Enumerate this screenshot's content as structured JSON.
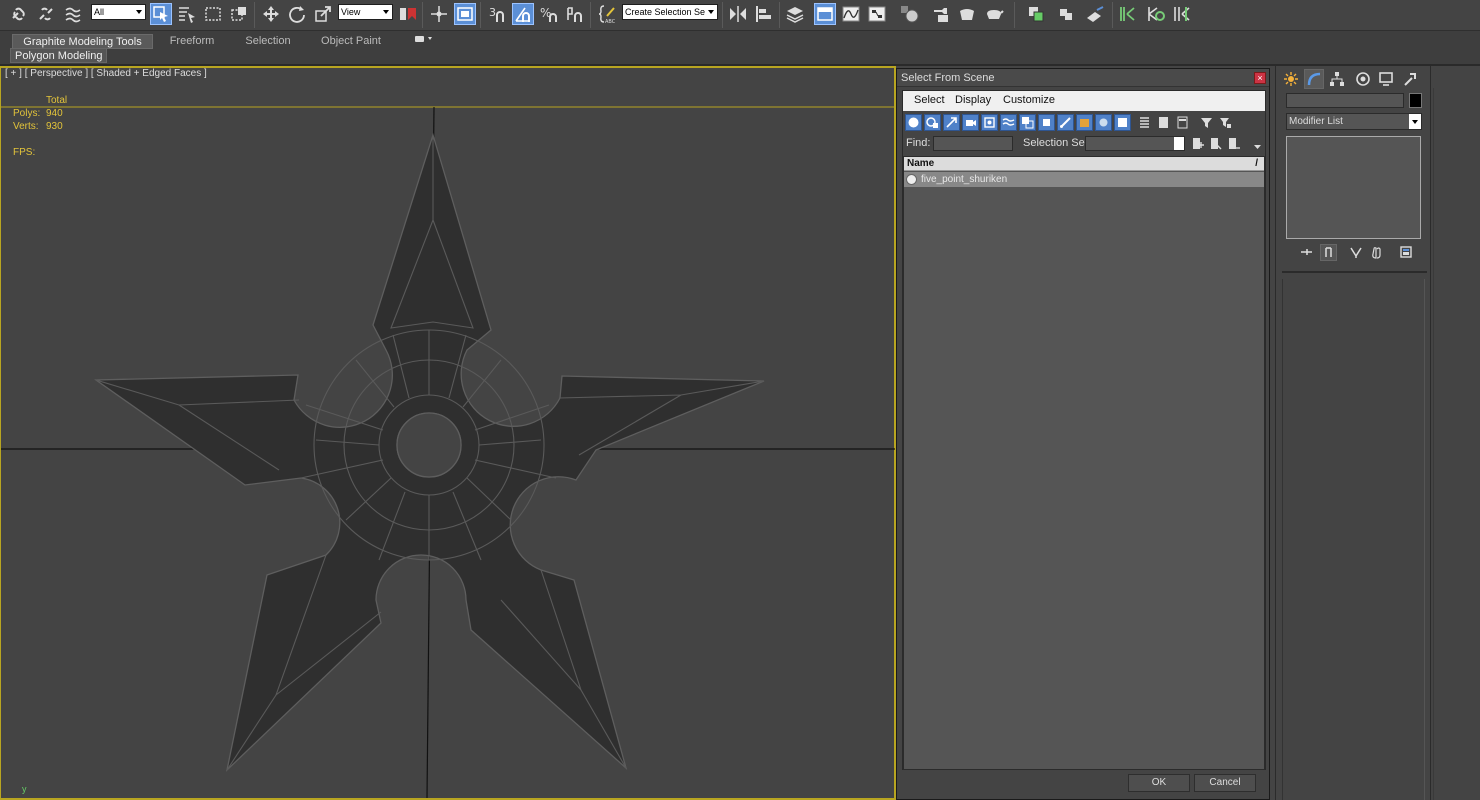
{
  "toolbar": {
    "filter_combo": "All",
    "ref_coord_combo": "View",
    "selection_set_combo": "Create Selection Se",
    "icons": [
      "link-icon",
      "unlink-icon",
      "bind-space-warp-icon",
      "select-object-icon",
      "select-by-name-icon",
      "rect-region-icon",
      "window-crossing-icon",
      "move-icon",
      "rotate-icon",
      "scale-icon",
      "use-pivot-icon",
      "select-manipulate-icon",
      "keyboard-shortcut-icon",
      "snap-3d-icon",
      "angle-snap-icon",
      "percent-snap-icon",
      "spinner-snap-icon",
      "edit-named-sets-icon",
      "mirror-icon",
      "align-icon",
      "layer-manager-icon",
      "graphite-toggle-icon",
      "curve-editor-icon",
      "schematic-view-icon",
      "material-editor-icon",
      "render-setup-icon",
      "rendered-frame-icon",
      "render-icon",
      "render-iterative-icon"
    ]
  },
  "ribbon": {
    "tabs": [
      "Graphite Modeling Tools",
      "Freeform",
      "Selection",
      "Object Paint"
    ],
    "active_tab": "Graphite Modeling Tools",
    "sub_panel": "Polygon Modeling"
  },
  "viewport": {
    "label": "[ + ] [ Perspective ] [ Shaded + Edged Faces ]",
    "stats_header": "Total",
    "stats": [
      {
        "key": "Polys:",
        "value": "940"
      },
      {
        "key": "Verts:",
        "value": "930"
      }
    ],
    "fps_label": "FPS:",
    "axis_label": "y",
    "border_color": "#b8a521",
    "stats_color": "#e3c43a"
  },
  "dialog": {
    "title": "Select From Scene",
    "close": "×",
    "menu": [
      "Select",
      "Display",
      "Customize"
    ],
    "find_label": "Find:",
    "find_value": "",
    "selection_set_label": "Selection Set:",
    "column_header": "Name",
    "column_sort": "/",
    "rows": [
      {
        "name": "five_point_shuriken"
      }
    ],
    "ok": "OK",
    "cancel": "Cancel"
  },
  "command_panel": {
    "tabs": [
      "create-icon",
      "modify-icon",
      "hierarchy-icon",
      "motion-icon",
      "display-icon",
      "utilities-icon"
    ],
    "active_tab": "modify-icon",
    "object_name": "",
    "modifier_list": "Modifier List",
    "object_color": "#000000"
  }
}
